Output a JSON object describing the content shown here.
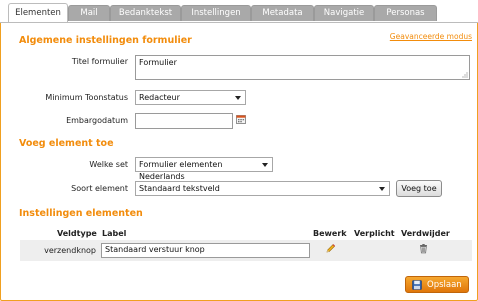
{
  "tabs": [
    {
      "label": "Elementen",
      "active": true
    },
    {
      "label": "Mail",
      "active": false
    },
    {
      "label": "Bedanktekst",
      "active": false
    },
    {
      "label": "Instellingen",
      "active": false
    },
    {
      "label": "Metadata",
      "active": false
    },
    {
      "label": "Navigatie",
      "active": false
    },
    {
      "label": "Personas",
      "active": false
    }
  ],
  "general": {
    "heading": "Algemene instellingen formulier",
    "advanced_link": "Geavanceerde modus",
    "title_label": "Titel formulier",
    "title_value": "Formulier",
    "min_status_label": "Minimum Toonstatus",
    "min_status_value": "Redacteur",
    "embargo_label": "Embargodatum",
    "embargo_value": ""
  },
  "add_element": {
    "heading": "Voeg element toe",
    "set_label": "Welke set",
    "set_value": "Formulier elementen Nederlands",
    "type_label": "Soort element",
    "type_value": "Standaard tekstveld",
    "add_button": "Voeg toe"
  },
  "element_settings": {
    "heading": "Instellingen elementen",
    "columns": {
      "fieldtype": "Veldtype",
      "label": "Label",
      "edit": "Bewerk",
      "required": "Verplicht",
      "delete": "Verdwijder"
    },
    "rows": [
      {
        "fieldtype": "verzendknop",
        "label": "Standaard verstuur knop"
      }
    ]
  },
  "save_button": "Opslaan",
  "colors": {
    "accent": "#f28c0c",
    "tab_inactive": "#a9a9a9",
    "frame": "#f0a020"
  }
}
